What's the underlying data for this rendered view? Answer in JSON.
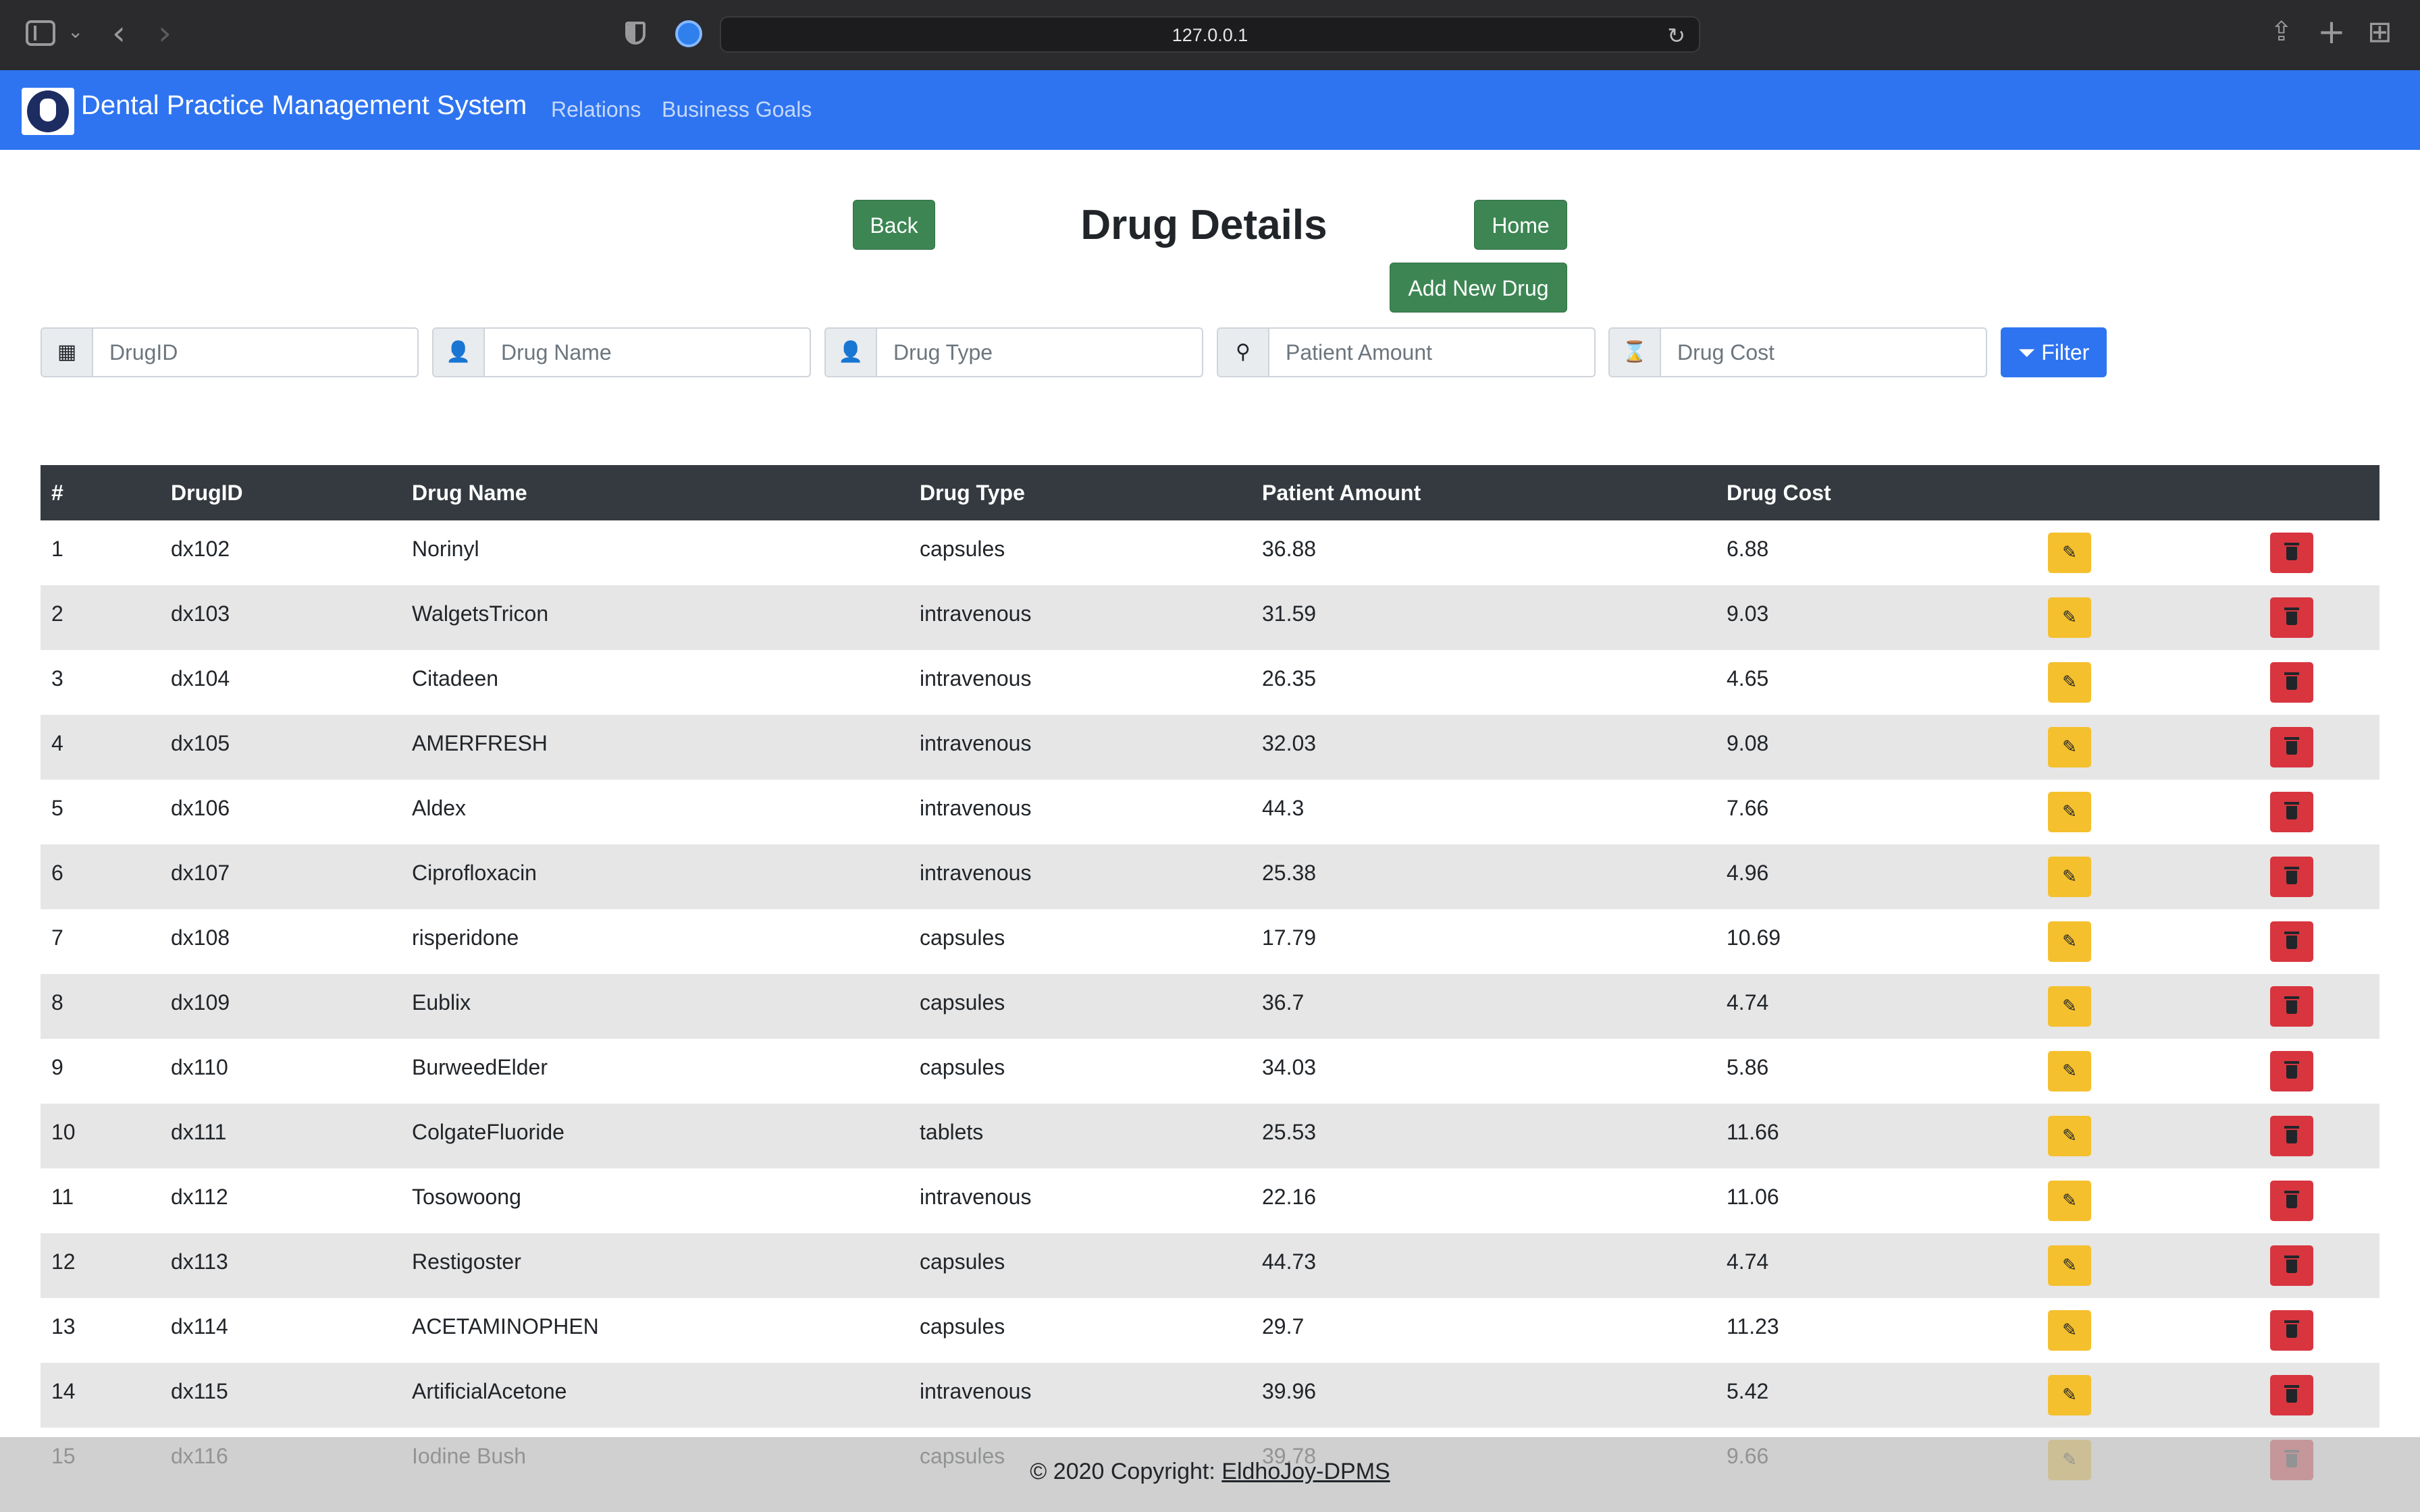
{
  "browser": {
    "url": "127.0.0.1",
    "icons": {
      "sidebar": "sidebar-icon",
      "back": "back-arrow-icon",
      "forward": "forward-arrow-icon",
      "reload": "reload-icon",
      "share": "share-icon",
      "new_tab": "plus-icon",
      "tabs": "tab-overview-icon"
    }
  },
  "navbar": {
    "brand": "Dental Practice Management System",
    "links": [
      "Relations",
      "Business Goals"
    ],
    "color": "#2e74f0"
  },
  "header": {
    "title": "Drug Details",
    "back_label": "Back",
    "home_label": "Home",
    "add_label": "Add New Drug"
  },
  "filters": {
    "drug_id": "DrugID",
    "drug_name": "Drug Name",
    "drug_type": "Drug Type",
    "patient_amount": "Patient Amount",
    "drug_cost": "Drug Cost",
    "filter_label": "Filter"
  },
  "table": {
    "columns": [
      "#",
      "DrugID",
      "Drug Name",
      "Drug Type",
      "Patient Amount",
      "Drug Cost"
    ],
    "rows": [
      [
        "1",
        "dx102",
        "Norinyl",
        "capsules",
        "36.88",
        "6.88"
      ],
      [
        "2",
        "dx103",
        "WalgetsTricon",
        "intravenous",
        "31.59",
        "9.03"
      ],
      [
        "3",
        "dx104",
        "Citadeen",
        "intravenous",
        "26.35",
        "4.65"
      ],
      [
        "4",
        "dx105",
        "AMERFRESH",
        "intravenous",
        "32.03",
        "9.08"
      ],
      [
        "5",
        "dx106",
        "Aldex",
        "intravenous",
        "44.3",
        "7.66"
      ],
      [
        "6",
        "dx107",
        "Ciprofloxacin",
        "intravenous",
        "25.38",
        "4.96"
      ],
      [
        "7",
        "dx108",
        "risperidone",
        "capsules",
        "17.79",
        "10.69"
      ],
      [
        "8",
        "dx109",
        "Eublix",
        "capsules",
        "36.7",
        "4.74"
      ],
      [
        "9",
        "dx110",
        "BurweedElder",
        "capsules",
        "34.03",
        "5.86"
      ],
      [
        "10",
        "dx111",
        "ColgateFluoride",
        "tablets",
        "25.53",
        "11.66"
      ],
      [
        "11",
        "dx112",
        "Tosowoong",
        "intravenous",
        "22.16",
        "11.06"
      ],
      [
        "12",
        "dx113",
        "Restigoster",
        "capsules",
        "44.73",
        "4.74"
      ],
      [
        "13",
        "dx114",
        "ACETAMINOPHEN",
        "capsules",
        "29.7",
        "11.23"
      ],
      [
        "14",
        "dx115",
        "ArtificialAcetone",
        "intravenous",
        "39.96",
        "5.42"
      ],
      [
        "15",
        "dx116",
        "Iodine Bush",
        "capsules",
        "39.78",
        "9.66"
      ]
    ]
  },
  "footer": {
    "text": "© 2020 Copyright: ",
    "link": "EldhoJoy-DPMS"
  }
}
